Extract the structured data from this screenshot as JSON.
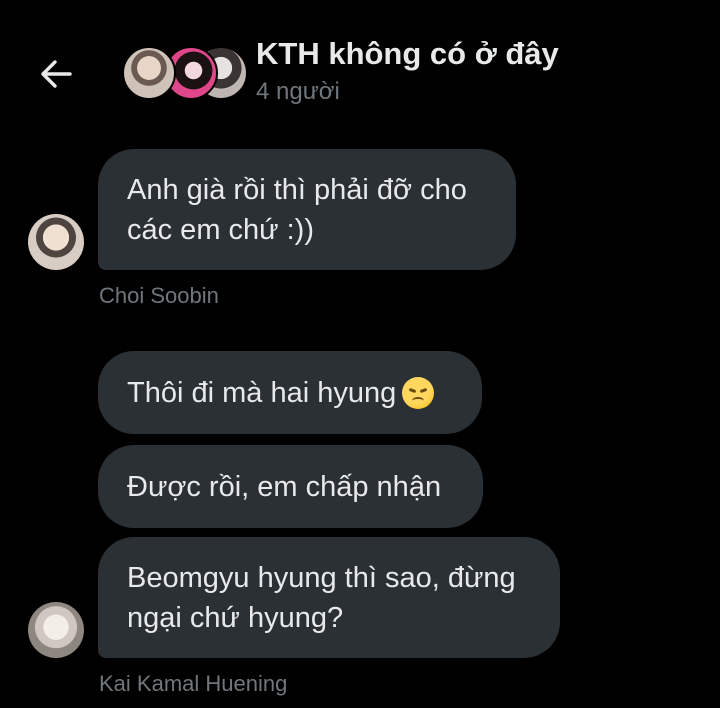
{
  "header": {
    "title": "KTH không có ở đây",
    "member_count": "4 người",
    "back_icon": "arrow-left-icon"
  },
  "messages": [
    {
      "text": "Anh già rồi thì phải đỡ cho\ncác em chứ :))",
      "sender": "Choi Soobin"
    },
    {
      "text": "Thôi đi mà hai hyung",
      "emoji": "disappointed-face"
    },
    {
      "text": "Được rồi, em chấp nhận"
    },
    {
      "text": "Beomgyu hyung thì sao, đừng\nngại chứ hyung?",
      "sender": "Kai Kamal Huening"
    }
  ],
  "colors": {
    "background": "#000000",
    "bubble": "#2b3035",
    "text": "#e7e9ea",
    "muted": "#71767b"
  }
}
